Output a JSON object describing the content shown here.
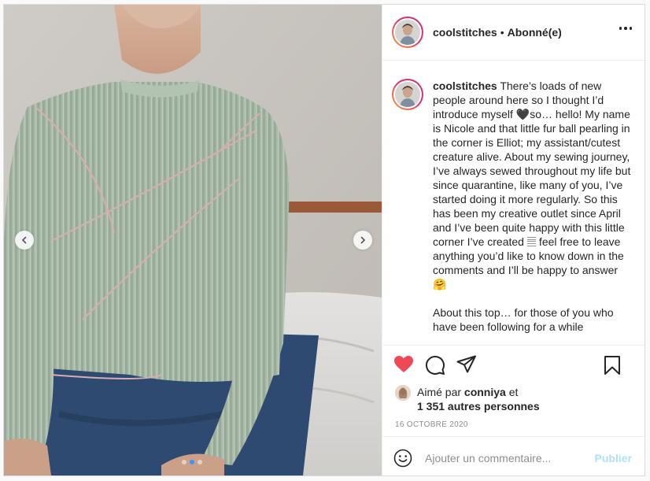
{
  "post": {
    "username": "coolstitches",
    "separator": "•",
    "follow_status": "Abonné(e)",
    "caption_paragraphs": [
      "There’s loads of new people around here so I thought I’d introduce myself 🖤so… hello! My name is Nicole and that little fur ball pearling in the corner is Elliot; my assistant/cutest creature alive. About my sewing journey, I’ve always sewed throughout my life but since quarantine, like many of you, I’ve started doing it more regularly. So this has been my creative outlet since April and I’ve been quite happy with this little corner I’ve created 𝄚 feel free to leave anything you’d like to know down in the comments and I’ll be happy to answer 🤗",
      "About this top… for those of you who have been following for a while"
    ],
    "likes": {
      "prefix": "Aimé par",
      "liker": "conniya",
      "connector": "et",
      "others": "1 351 autres personnes"
    },
    "date": "16 OCTOBRE 2020"
  },
  "comment_box": {
    "placeholder": "Ajouter un commentaire...",
    "submit_label": "Publier"
  },
  "carousel": {
    "slide_count": 3,
    "active_index": 1
  },
  "colors": {
    "like_red": "#ed4956",
    "active_dot": "#3897f0",
    "publish_disabled": "#b2dffc"
  },
  "icons": {
    "like": "heart-filled-icon",
    "comment": "comment-icon",
    "share": "share-icon",
    "save": "bookmark-icon",
    "emoji": "smiley-icon",
    "more": "more-options-icon",
    "prev": "chevron-left-icon",
    "next": "chevron-right-icon"
  }
}
